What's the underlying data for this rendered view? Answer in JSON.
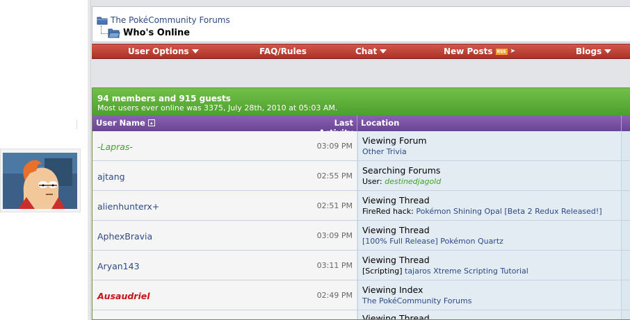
{
  "breadcrumb": {
    "forum_link": "The PokéCommunity Forums",
    "page_title": "Who's Online"
  },
  "navbar": {
    "items": [
      {
        "label": "User Options",
        "dropdown": true
      },
      {
        "label": "FAQ/Rules",
        "dropdown": false
      },
      {
        "label": "Chat",
        "dropdown": true
      },
      {
        "label": "New Posts",
        "dropdown": false,
        "badge": "RSS"
      },
      {
        "label": "Blogs",
        "dropdown": true
      }
    ]
  },
  "online": {
    "summary": "94 members and 915 guests",
    "record": "Most users ever online was 3375, July 28th, 2010 at 05:03 AM.",
    "columns": {
      "user_name": "User Name",
      "last_activity": "Last Activity",
      "location": "Location"
    },
    "rows": [
      {
        "user": "-Lapras-",
        "style": "green",
        "time": "03:09 PM",
        "action": "Viewing Forum",
        "detail_prefix": "",
        "detail_link": "Other Trivia",
        "detail_style": "link"
      },
      {
        "user": "ajtang",
        "style": "normal",
        "time": "02:55 PM",
        "action": "Searching Forums",
        "detail_prefix": "User: ",
        "detail_link": "destinedjagold",
        "detail_style": "glink"
      },
      {
        "user": "alienhunterx+",
        "style": "normal",
        "time": "02:51 PM",
        "action": "Viewing Thread",
        "detail_prefix": "FireRed hack: ",
        "detail_link": "Pokémon Shining Opal [Beta 2 Redux Released!]",
        "detail_style": "link"
      },
      {
        "user": "AphexBravia",
        "style": "normal",
        "time": "03:09 PM",
        "action": "Viewing Thread",
        "detail_prefix": "",
        "detail_link": "[100% Full Release] Pokémon Quartz",
        "detail_style": "link"
      },
      {
        "user": "Aryan143",
        "style": "normal",
        "time": "03:11 PM",
        "action": "Viewing Thread",
        "detail_prefix": "[Scripting] ",
        "detail_link": "tajaros Xtreme Scripting Tutorial",
        "detail_style": "link"
      },
      {
        "user": "Ausaudriel",
        "style": "red",
        "time": "02:49 PM",
        "action": "Viewing Index",
        "detail_prefix": "",
        "detail_link": "The PokéCommunity Forums",
        "detail_style": "link"
      }
    ],
    "partial_row_action": "Viewing Thread"
  },
  "colors": {
    "nav_red": "#b63a2e",
    "green_header": "#5aad35",
    "purple_header": "#7a52a6",
    "link_blue": "#2d4a86",
    "member_green": "#3fa329",
    "member_red": "#c81212"
  },
  "icons": {
    "crumb_folder": "folder-icon",
    "avatar": "avatar-image",
    "sort": "sort-icon"
  }
}
